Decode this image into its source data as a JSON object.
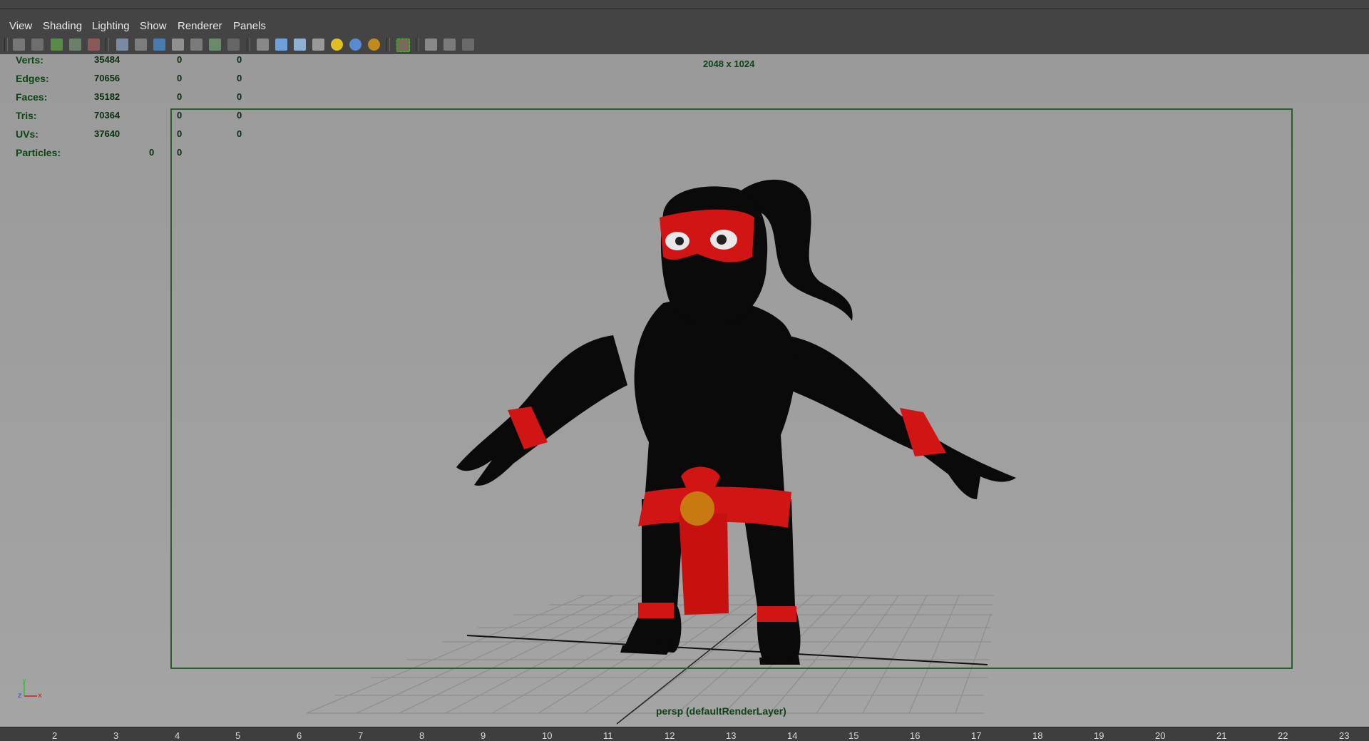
{
  "menubar": {
    "items": [
      "View",
      "Shading",
      "Lighting",
      "Show",
      "Renderer",
      "Panels"
    ]
  },
  "toolbar": {
    "icons": [
      "select-camera-icon",
      "camera-attributes-icon",
      "bookmarks-icon",
      "image-plane-icon",
      "2d-pan-zoom-icon",
      "grid-icon",
      "film-gate-icon",
      "resolution-gate-icon",
      "gate-mask-icon",
      "field-chart-icon",
      "safe-action-icon",
      "wireframe-icon",
      "smooth-shade-icon",
      "shaded-wireframe-icon",
      "textured-icon",
      "default-light-icon",
      "all-lights-icon",
      "isolate-select-icon",
      "xray-icon",
      "xray-joints-icon",
      "xray-components-icon"
    ]
  },
  "hud": {
    "rows": [
      {
        "label": "Verts:",
        "v1": "35484",
        "v2": "0",
        "v3": "0"
      },
      {
        "label": "Edges:",
        "v1": "70656",
        "v2": "0",
        "v3": "0"
      },
      {
        "label": "Faces:",
        "v1": "35182",
        "v2": "0",
        "v3": "0"
      },
      {
        "label": "Tris:",
        "v1": "70364",
        "v2": "0",
        "v3": "0"
      },
      {
        "label": "UVs:",
        "v1": "37640",
        "v2": "0",
        "v3": "0"
      }
    ],
    "particles": {
      "label": "Particles:",
      "v1": "0",
      "v2": "0"
    },
    "resolution": "2048 x 1024",
    "camera": "persp (defaultRenderLayer)"
  },
  "ruler": {
    "ticks": [
      "2",
      "3",
      "4",
      "5",
      "6",
      "7",
      "8",
      "9",
      "10",
      "11",
      "12",
      "13",
      "14",
      "15",
      "16",
      "17",
      "18",
      "19",
      "20",
      "21",
      "22",
      "23"
    ]
  },
  "colors": {
    "viewport_bg": "#9b9b9b",
    "hud_text": "#0f4416",
    "gate_border": "#2a5e2a",
    "ninja_body": "#0a0a0a",
    "ninja_red": "#d11414",
    "buckle": "#c87a10"
  }
}
